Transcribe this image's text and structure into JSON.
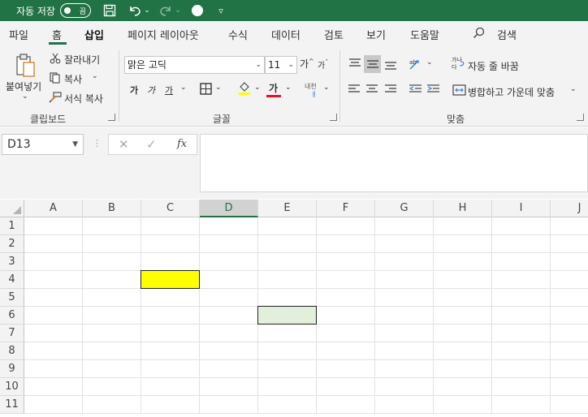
{
  "titlebar": {
    "autosave_label": "자동 저장",
    "autosave_state": "끔",
    "bg_color": "#217346",
    "quick_access_icons": [
      "save-icon",
      "undo-icon",
      "redo-icon",
      "circle-icon",
      "customize-icon"
    ]
  },
  "menu": {
    "tabs": [
      {
        "label": "파일"
      },
      {
        "label": "홈"
      },
      {
        "label": "삽입"
      },
      {
        "label": "페이지 레이아웃"
      },
      {
        "label": "수식"
      },
      {
        "label": "데이터"
      },
      {
        "label": "검토"
      },
      {
        "label": "보기"
      },
      {
        "label": "도움말"
      }
    ],
    "active_tab": "삽입",
    "search_label": "검색"
  },
  "ribbon": {
    "clipboard": {
      "paste_label": "붙여넣기",
      "cut_label": "잘라내기",
      "copy_label": "복사",
      "format_painter_label": "서식 복사",
      "group_label": "클립보드"
    },
    "font": {
      "font_name": "맑은 고딕",
      "font_size": "11",
      "grow_label": "가",
      "shrink_label": "가",
      "bold_label": "가",
      "italic_label": "가",
      "underline_label": "가",
      "font_color_label": "가",
      "phonetic_label": "내천",
      "group_label": "글꼴",
      "font_color": "#e81123"
    },
    "alignment": {
      "wrap_text_label": "자동 줄 바꿈",
      "merge_center_label": "병합하고 가운데 맞춤",
      "group_label": "맞춤"
    }
  },
  "formula_bar": {
    "name_box": "D13",
    "cancel_icon": "✕",
    "enter_icon": "✓",
    "fx_label": "fx",
    "formula": ""
  },
  "sheet": {
    "columns": [
      "A",
      "B",
      "C",
      "D",
      "E",
      "F",
      "G",
      "H",
      "I",
      "J"
    ],
    "rows": [
      "1",
      "2",
      "3",
      "4",
      "5",
      "6",
      "7",
      "8",
      "9",
      "10",
      "11"
    ],
    "selected_column": "D",
    "filled_cells": [
      {
        "ref": "C4",
        "color": "#ffff00"
      },
      {
        "ref": "E6",
        "color": "#e2efda"
      }
    ]
  }
}
